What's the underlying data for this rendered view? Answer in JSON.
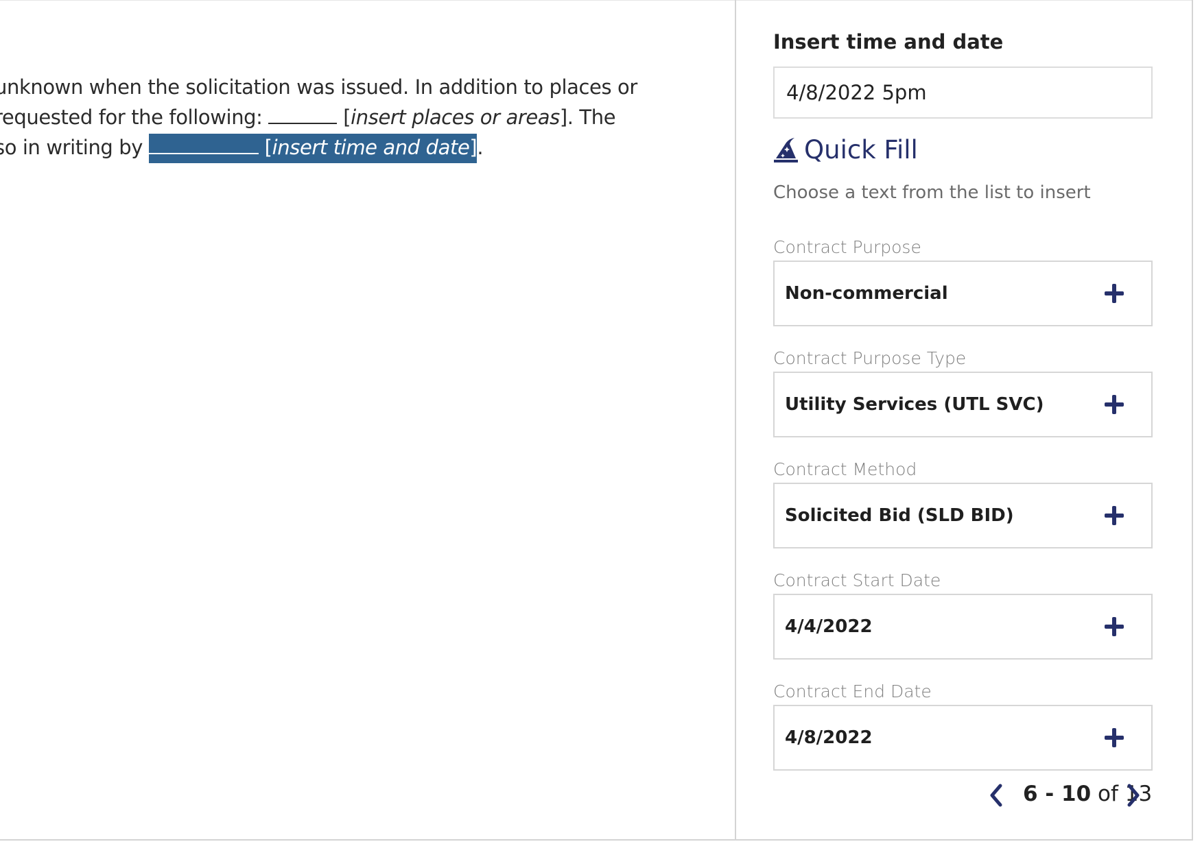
{
  "document": {
    "line1": "unknown when the solicitation was issued. In addition to places or",
    "line2_prefix": "requested for the following: ",
    "line2_placeholder": "[insert places or areas]",
    "line2_placeholder_text": "insert places or areas",
    "line2_suffix": ". The",
    "line3_prefix": "so in writing by ",
    "line3_placeholder_text": "insert time and date",
    "line3_suffix": "."
  },
  "panel": {
    "title": "Insert time and date",
    "time_input_value": "4/8/2022 5pm",
    "quick_fill": {
      "icon": "wizard-hat-icon",
      "label": "Quick Fill",
      "hint": "Choose a text from the list to insert"
    },
    "fields": [
      {
        "label": "Contract Purpose",
        "value": "Non-commercial"
      },
      {
        "label": "Contract Purpose Type",
        "value": "Utility Services (UTL SVC)"
      },
      {
        "label": "Contract Method",
        "value": "Solicited Bid (SLD BID)"
      },
      {
        "label": "Contract Start Date",
        "value": "4/4/2022"
      },
      {
        "label": "Contract End Date",
        "value": "4/8/2022"
      }
    ],
    "pager": {
      "range": "6 - 10",
      "of_label": "of",
      "total": "13"
    }
  },
  "colors": {
    "accent": "#26306b",
    "highlight": "#2f6391",
    "border": "#d6d6d6"
  }
}
